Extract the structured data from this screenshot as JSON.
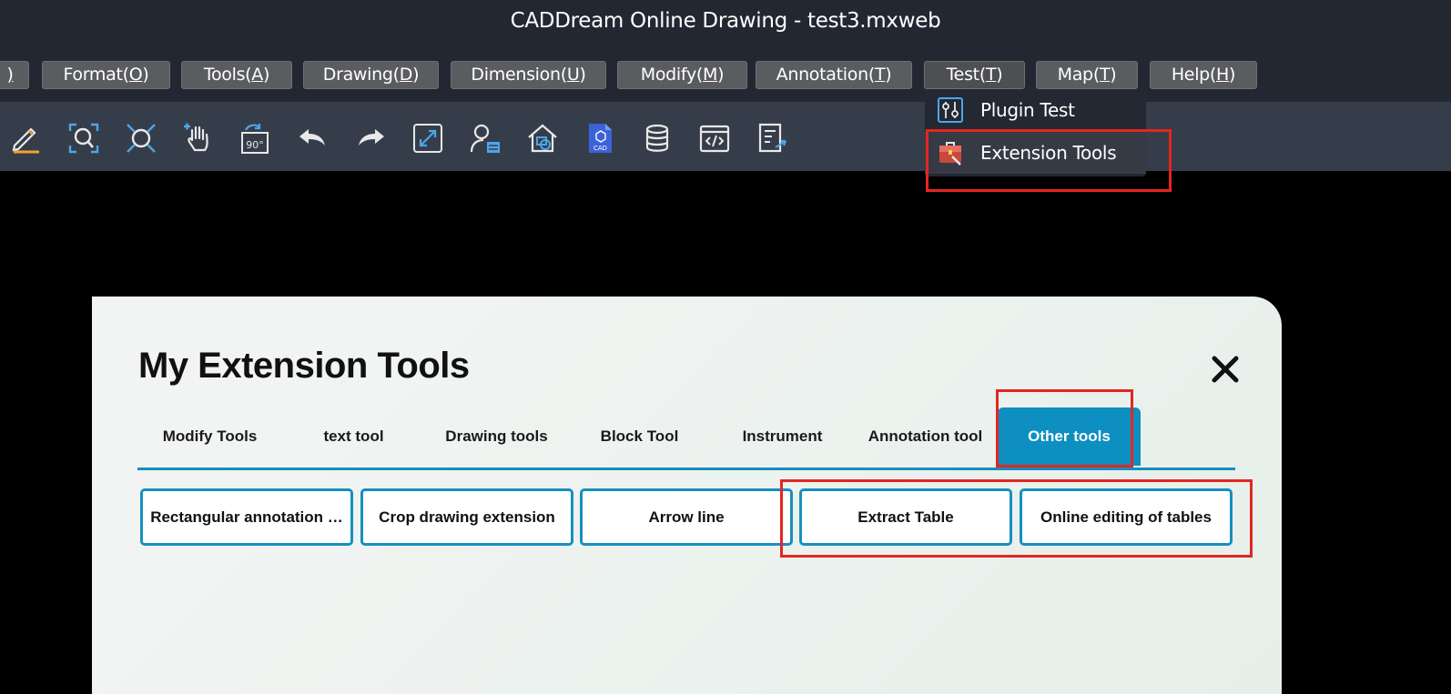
{
  "window": {
    "title": "CADDream Online Drawing - test3.mxweb"
  },
  "menubar": {
    "items": [
      {
        "label": ")",
        "key": ""
      },
      {
        "label": "Format(",
        "key": "O",
        "tail": ")"
      },
      {
        "label": "Tools(",
        "key": "A",
        "tail": ")"
      },
      {
        "label": "Drawing(",
        "key": "D",
        "tail": ")"
      },
      {
        "label": "Dimension(",
        "key": "U",
        "tail": ")"
      },
      {
        "label": "Modify(",
        "key": "M",
        "tail": ")"
      },
      {
        "label": "Annotation(",
        "key": "T",
        "tail": ")"
      },
      {
        "label": "Test(",
        "key": "T",
        "tail": ")"
      },
      {
        "label": "Map(",
        "key": "T",
        "tail": ")"
      },
      {
        "label": "Help(",
        "key": "H",
        "tail": ")"
      }
    ]
  },
  "toolbar": {
    "icons": [
      "pen-edit-icon",
      "zoom-window-icon",
      "zoom-extents-icon",
      "pan-hand-icon",
      "rotate-90-icon",
      "undo-icon",
      "redo-icon",
      "fullscreen-icon",
      "user-layer-icon",
      "house-view-icon",
      "cad-file-icon",
      "database-icon",
      "code-icon",
      "export-icon"
    ],
    "rotate_label": "90°",
    "cad_label": "CAD"
  },
  "dropdown": {
    "items": [
      {
        "label": "Plugin Test",
        "icon": "sliders-icon"
      },
      {
        "label": "Extension Tools",
        "icon": "toolbox-icon"
      }
    ]
  },
  "panel": {
    "title": "My Extension Tools",
    "close_icon": "close-icon",
    "tabs": [
      "Modify Tools",
      "text tool",
      "Drawing tools",
      "Block Tool",
      "Instrument",
      "Annotation tool",
      "Other tools"
    ],
    "active_tab": "Other tools",
    "tools": [
      "Rectangular annotation …",
      "Crop drawing extension",
      "Arrow line",
      "Extract Table",
      "Online editing of tables"
    ]
  },
  "colors": {
    "accent": "#0d8fc2",
    "highlight": "#e3261f",
    "toolbar_bg": "#363d4a",
    "titlebar_bg": "#222732"
  }
}
